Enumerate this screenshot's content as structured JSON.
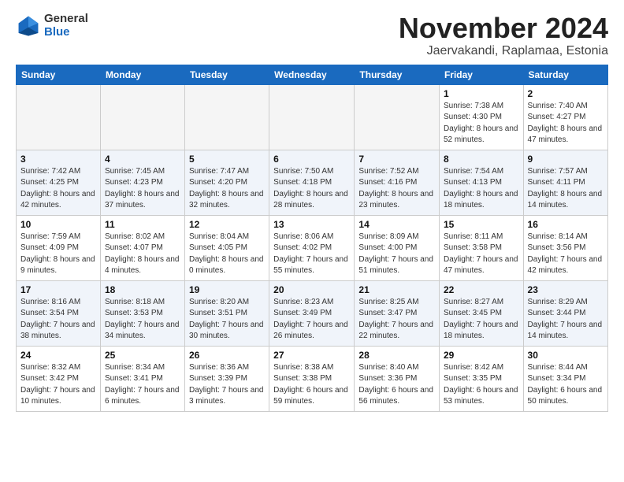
{
  "header": {
    "logo_general": "General",
    "logo_blue": "Blue",
    "month_title": "November 2024",
    "subtitle": "Jaervakandi, Raplamaa, Estonia"
  },
  "weekdays": [
    "Sunday",
    "Monday",
    "Tuesday",
    "Wednesday",
    "Thursday",
    "Friday",
    "Saturday"
  ],
  "weeks": [
    [
      {
        "day": "",
        "info": ""
      },
      {
        "day": "",
        "info": ""
      },
      {
        "day": "",
        "info": ""
      },
      {
        "day": "",
        "info": ""
      },
      {
        "day": "",
        "info": ""
      },
      {
        "day": "1",
        "info": "Sunrise: 7:38 AM\nSunset: 4:30 PM\nDaylight: 8 hours\nand 52 minutes."
      },
      {
        "day": "2",
        "info": "Sunrise: 7:40 AM\nSunset: 4:27 PM\nDaylight: 8 hours\nand 47 minutes."
      }
    ],
    [
      {
        "day": "3",
        "info": "Sunrise: 7:42 AM\nSunset: 4:25 PM\nDaylight: 8 hours\nand 42 minutes."
      },
      {
        "day": "4",
        "info": "Sunrise: 7:45 AM\nSunset: 4:23 PM\nDaylight: 8 hours\nand 37 minutes."
      },
      {
        "day": "5",
        "info": "Sunrise: 7:47 AM\nSunset: 4:20 PM\nDaylight: 8 hours\nand 32 minutes."
      },
      {
        "day": "6",
        "info": "Sunrise: 7:50 AM\nSunset: 4:18 PM\nDaylight: 8 hours\nand 28 minutes."
      },
      {
        "day": "7",
        "info": "Sunrise: 7:52 AM\nSunset: 4:16 PM\nDaylight: 8 hours\nand 23 minutes."
      },
      {
        "day": "8",
        "info": "Sunrise: 7:54 AM\nSunset: 4:13 PM\nDaylight: 8 hours\nand 18 minutes."
      },
      {
        "day": "9",
        "info": "Sunrise: 7:57 AM\nSunset: 4:11 PM\nDaylight: 8 hours\nand 14 minutes."
      }
    ],
    [
      {
        "day": "10",
        "info": "Sunrise: 7:59 AM\nSunset: 4:09 PM\nDaylight: 8 hours\nand 9 minutes."
      },
      {
        "day": "11",
        "info": "Sunrise: 8:02 AM\nSunset: 4:07 PM\nDaylight: 8 hours\nand 4 minutes."
      },
      {
        "day": "12",
        "info": "Sunrise: 8:04 AM\nSunset: 4:05 PM\nDaylight: 8 hours\nand 0 minutes."
      },
      {
        "day": "13",
        "info": "Sunrise: 8:06 AM\nSunset: 4:02 PM\nDaylight: 7 hours\nand 55 minutes."
      },
      {
        "day": "14",
        "info": "Sunrise: 8:09 AM\nSunset: 4:00 PM\nDaylight: 7 hours\nand 51 minutes."
      },
      {
        "day": "15",
        "info": "Sunrise: 8:11 AM\nSunset: 3:58 PM\nDaylight: 7 hours\nand 47 minutes."
      },
      {
        "day": "16",
        "info": "Sunrise: 8:14 AM\nSunset: 3:56 PM\nDaylight: 7 hours\nand 42 minutes."
      }
    ],
    [
      {
        "day": "17",
        "info": "Sunrise: 8:16 AM\nSunset: 3:54 PM\nDaylight: 7 hours\nand 38 minutes."
      },
      {
        "day": "18",
        "info": "Sunrise: 8:18 AM\nSunset: 3:53 PM\nDaylight: 7 hours\nand 34 minutes."
      },
      {
        "day": "19",
        "info": "Sunrise: 8:20 AM\nSunset: 3:51 PM\nDaylight: 7 hours\nand 30 minutes."
      },
      {
        "day": "20",
        "info": "Sunrise: 8:23 AM\nSunset: 3:49 PM\nDaylight: 7 hours\nand 26 minutes."
      },
      {
        "day": "21",
        "info": "Sunrise: 8:25 AM\nSunset: 3:47 PM\nDaylight: 7 hours\nand 22 minutes."
      },
      {
        "day": "22",
        "info": "Sunrise: 8:27 AM\nSunset: 3:45 PM\nDaylight: 7 hours\nand 18 minutes."
      },
      {
        "day": "23",
        "info": "Sunrise: 8:29 AM\nSunset: 3:44 PM\nDaylight: 7 hours\nand 14 minutes."
      }
    ],
    [
      {
        "day": "24",
        "info": "Sunrise: 8:32 AM\nSunset: 3:42 PM\nDaylight: 7 hours\nand 10 minutes."
      },
      {
        "day": "25",
        "info": "Sunrise: 8:34 AM\nSunset: 3:41 PM\nDaylight: 7 hours\nand 6 minutes."
      },
      {
        "day": "26",
        "info": "Sunrise: 8:36 AM\nSunset: 3:39 PM\nDaylight: 7 hours\nand 3 minutes."
      },
      {
        "day": "27",
        "info": "Sunrise: 8:38 AM\nSunset: 3:38 PM\nDaylight: 6 hours\nand 59 minutes."
      },
      {
        "day": "28",
        "info": "Sunrise: 8:40 AM\nSunset: 3:36 PM\nDaylight: 6 hours\nand 56 minutes."
      },
      {
        "day": "29",
        "info": "Sunrise: 8:42 AM\nSunset: 3:35 PM\nDaylight: 6 hours\nand 53 minutes."
      },
      {
        "day": "30",
        "info": "Sunrise: 8:44 AM\nSunset: 3:34 PM\nDaylight: 6 hours\nand 50 minutes."
      }
    ]
  ]
}
